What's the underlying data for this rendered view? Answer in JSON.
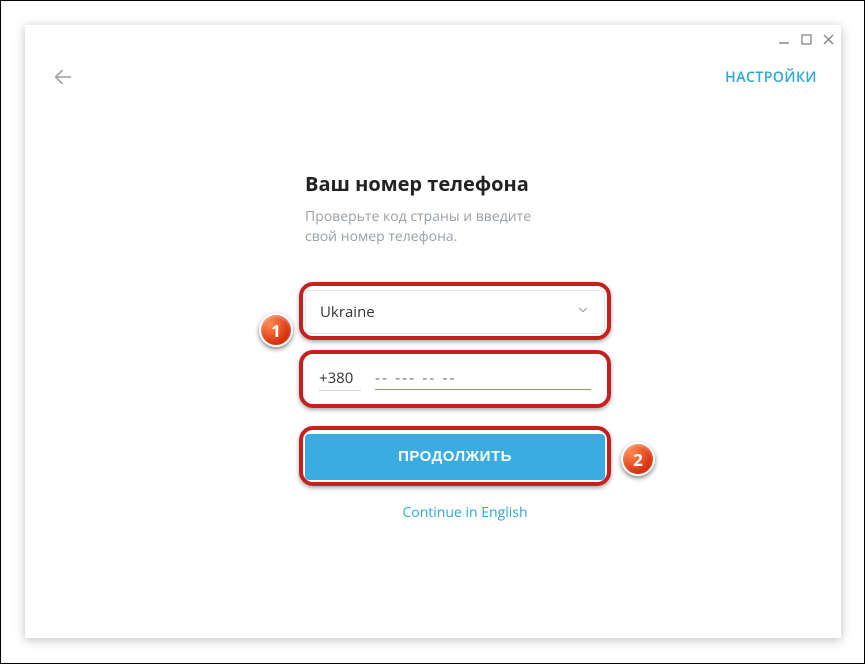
{
  "topbar": {
    "settings_label": "НАСТРОЙКИ"
  },
  "content": {
    "title": "Ваш номер телефона",
    "subtitle": "Проверьте код страны и введите свой номер телефона."
  },
  "country": {
    "selected": "Ukraine"
  },
  "phone": {
    "country_code": "+380",
    "placeholder": "-- --- -- --"
  },
  "continue": {
    "label": "ПРОДОЛЖИТЬ"
  },
  "lang_switch": {
    "label": "Continue in English"
  },
  "callouts": {
    "one": "1",
    "two": "2"
  }
}
